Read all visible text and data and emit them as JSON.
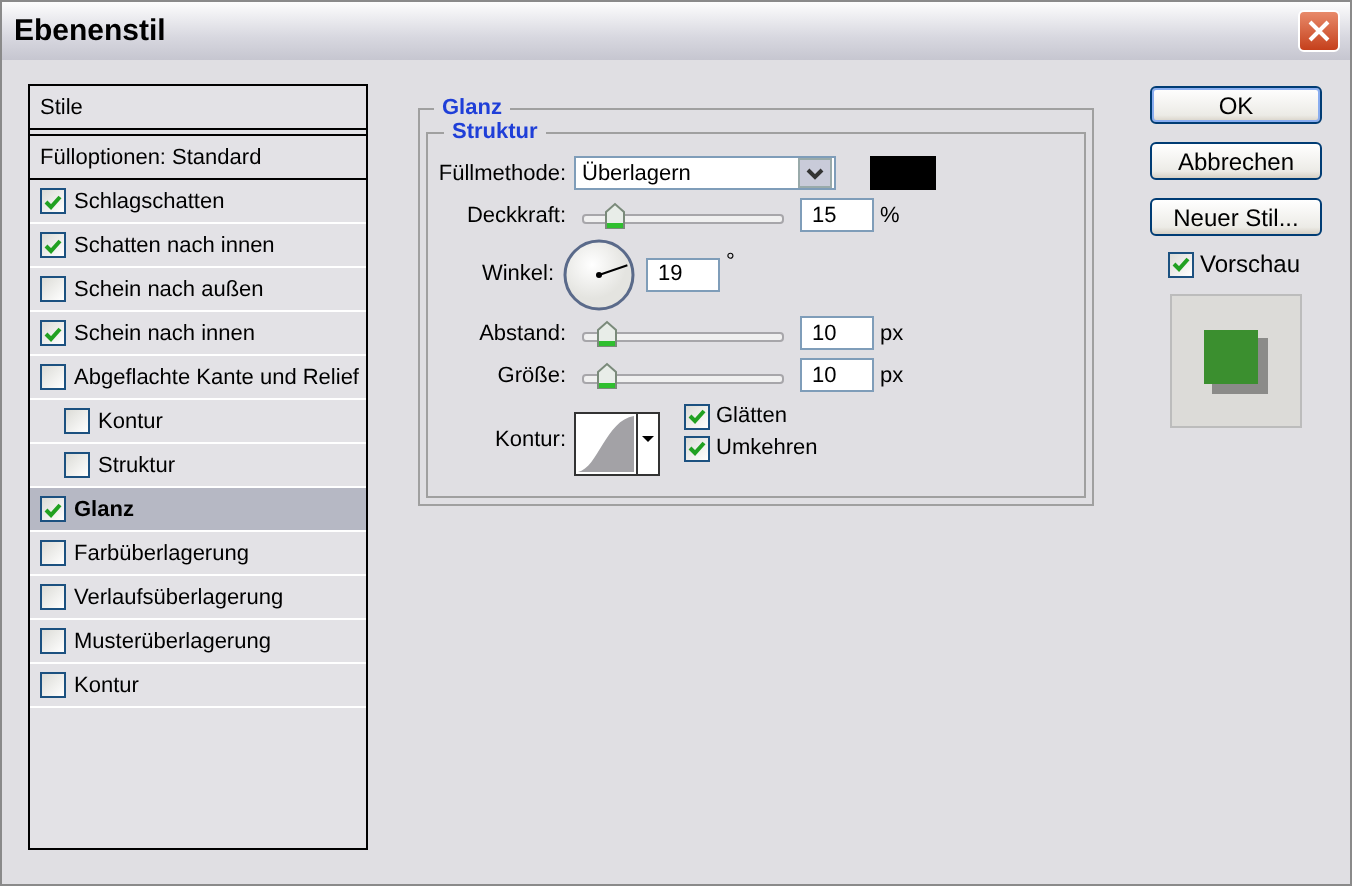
{
  "window": {
    "title": "Ebenenstil"
  },
  "styles": {
    "header": "Stile",
    "items": [
      {
        "label": "Fülloptionen: Standard",
        "kind": "plain",
        "selected": false
      },
      {
        "label": "Schlagschatten",
        "kind": "check",
        "checked": true,
        "selected": false
      },
      {
        "label": "Schatten nach innen",
        "kind": "check",
        "checked": true,
        "selected": false
      },
      {
        "label": "Schein nach außen",
        "kind": "check",
        "checked": false,
        "selected": false
      },
      {
        "label": "Schein nach innen",
        "kind": "check",
        "checked": true,
        "selected": false
      },
      {
        "label": "Abgeflachte Kante und Relief",
        "kind": "check",
        "checked": false,
        "selected": false,
        "children": [
          {
            "label": "Kontur",
            "kind": "check",
            "checked": false,
            "selected": false
          },
          {
            "label": "Struktur",
            "kind": "check",
            "checked": false,
            "selected": false
          }
        ]
      },
      {
        "label": "Glanz",
        "kind": "check",
        "checked": true,
        "selected": true
      },
      {
        "label": "Farbüberlagerung",
        "kind": "check",
        "checked": false,
        "selected": false
      },
      {
        "label": "Verlaufsüberlagerung",
        "kind": "check",
        "checked": false,
        "selected": false
      },
      {
        "label": "Musterüberlagerung",
        "kind": "check",
        "checked": false,
        "selected": false
      },
      {
        "label": "Kontur",
        "kind": "check",
        "checked": false,
        "selected": false
      }
    ]
  },
  "section": {
    "title": "Glanz",
    "group": "Struktur",
    "rows": [
      {
        "kind": "select",
        "label": "Füllmethode:",
        "value": "Überlagern",
        "color": "#000000"
      },
      {
        "kind": "slider",
        "label": "Deckkraft:",
        "level": 0.12,
        "value": "15",
        "unit": "%"
      },
      {
        "kind": "angle",
        "label": "Winkel:",
        "value": "19",
        "unit": "°"
      },
      {
        "kind": "slider",
        "label": "Abstand:",
        "level": 0.08,
        "value": "10",
        "unit": "px"
      },
      {
        "kind": "slider",
        "label": "Größe:",
        "level": 0.08,
        "value": "10",
        "unit": "px"
      },
      {
        "kind": "contour",
        "label": "Kontur:",
        "options": [
          {
            "label": "Glätten",
            "checked": true
          },
          {
            "label": "Umkehren",
            "checked": true
          }
        ]
      }
    ]
  },
  "buttons": [
    "OK",
    "Abbrechen",
    "Neuer Stil..."
  ],
  "preview": {
    "label": "Vorschau",
    "checked": true
  }
}
